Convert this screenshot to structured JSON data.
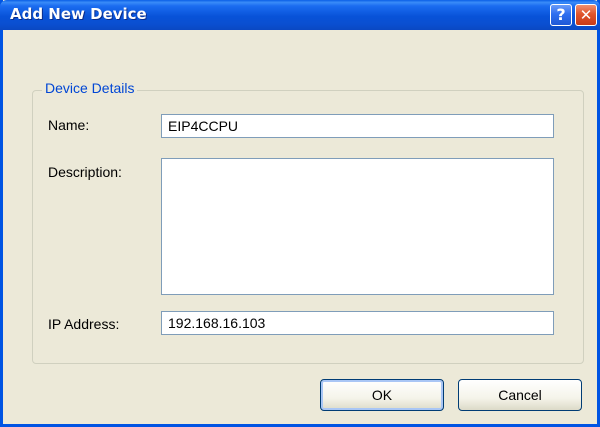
{
  "window": {
    "title": "Add New Device",
    "help_symbol": "?",
    "close_symbol": "✕"
  },
  "group": {
    "legend": "Device Details"
  },
  "fields": {
    "name": {
      "label": "Name:",
      "value": "EIP4CCPU"
    },
    "description": {
      "label": "Description:",
      "value": ""
    },
    "ip_address": {
      "label": "IP Address:",
      "value": "192.168.16.103"
    }
  },
  "buttons": {
    "ok": "OK",
    "cancel": "Cancel"
  },
  "icons": {
    "help": "question-mark-icon",
    "close": "close-icon"
  },
  "colors": {
    "titlebar": "#0852d8",
    "window_frame": "#0054e3",
    "dialog_bg": "#ece9d8",
    "group_legend": "#0046d5",
    "close_button": "#e0542c"
  }
}
